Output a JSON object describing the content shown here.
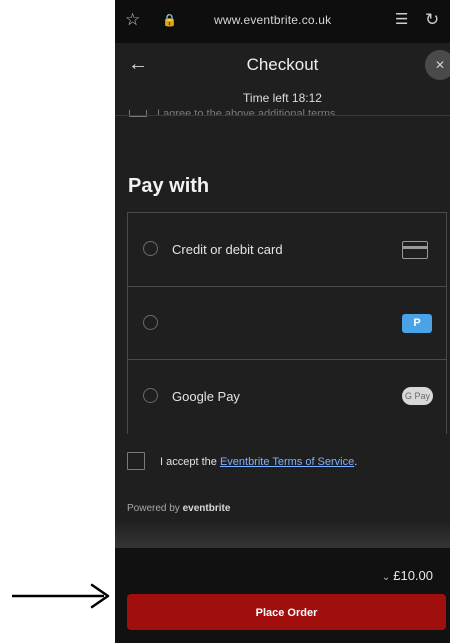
{
  "browser": {
    "url": "www.eventbrite.co.uk",
    "icons": [
      "star-icon",
      "lock-icon",
      "reader-mode-icon",
      "reload-icon"
    ]
  },
  "checkout": {
    "title": "Checkout",
    "timer": "Time left 18:12",
    "cut_off_text": "I agree to the above additional terms."
  },
  "pay_with": {
    "heading": "Pay with",
    "options": [
      {
        "label": "Credit or debit card",
        "icon": "credit-card-icon"
      },
      {
        "label": "",
        "icon": "paypal-icon"
      },
      {
        "label": "Google Pay",
        "icon": "google-pay-icon",
        "badge": "G Pay"
      }
    ]
  },
  "terms": {
    "prefix": "I accept the ",
    "link": "Eventbrite Terms of Service",
    "suffix": "."
  },
  "powered": {
    "prefix": "Powered by ",
    "brand": "eventbrite"
  },
  "footer": {
    "total": "£10.00",
    "place_order_label": "Place Order"
  },
  "colors": {
    "background": "#1f1f1f",
    "accent_button": "#a10e0e",
    "link": "#7fb0ff"
  }
}
